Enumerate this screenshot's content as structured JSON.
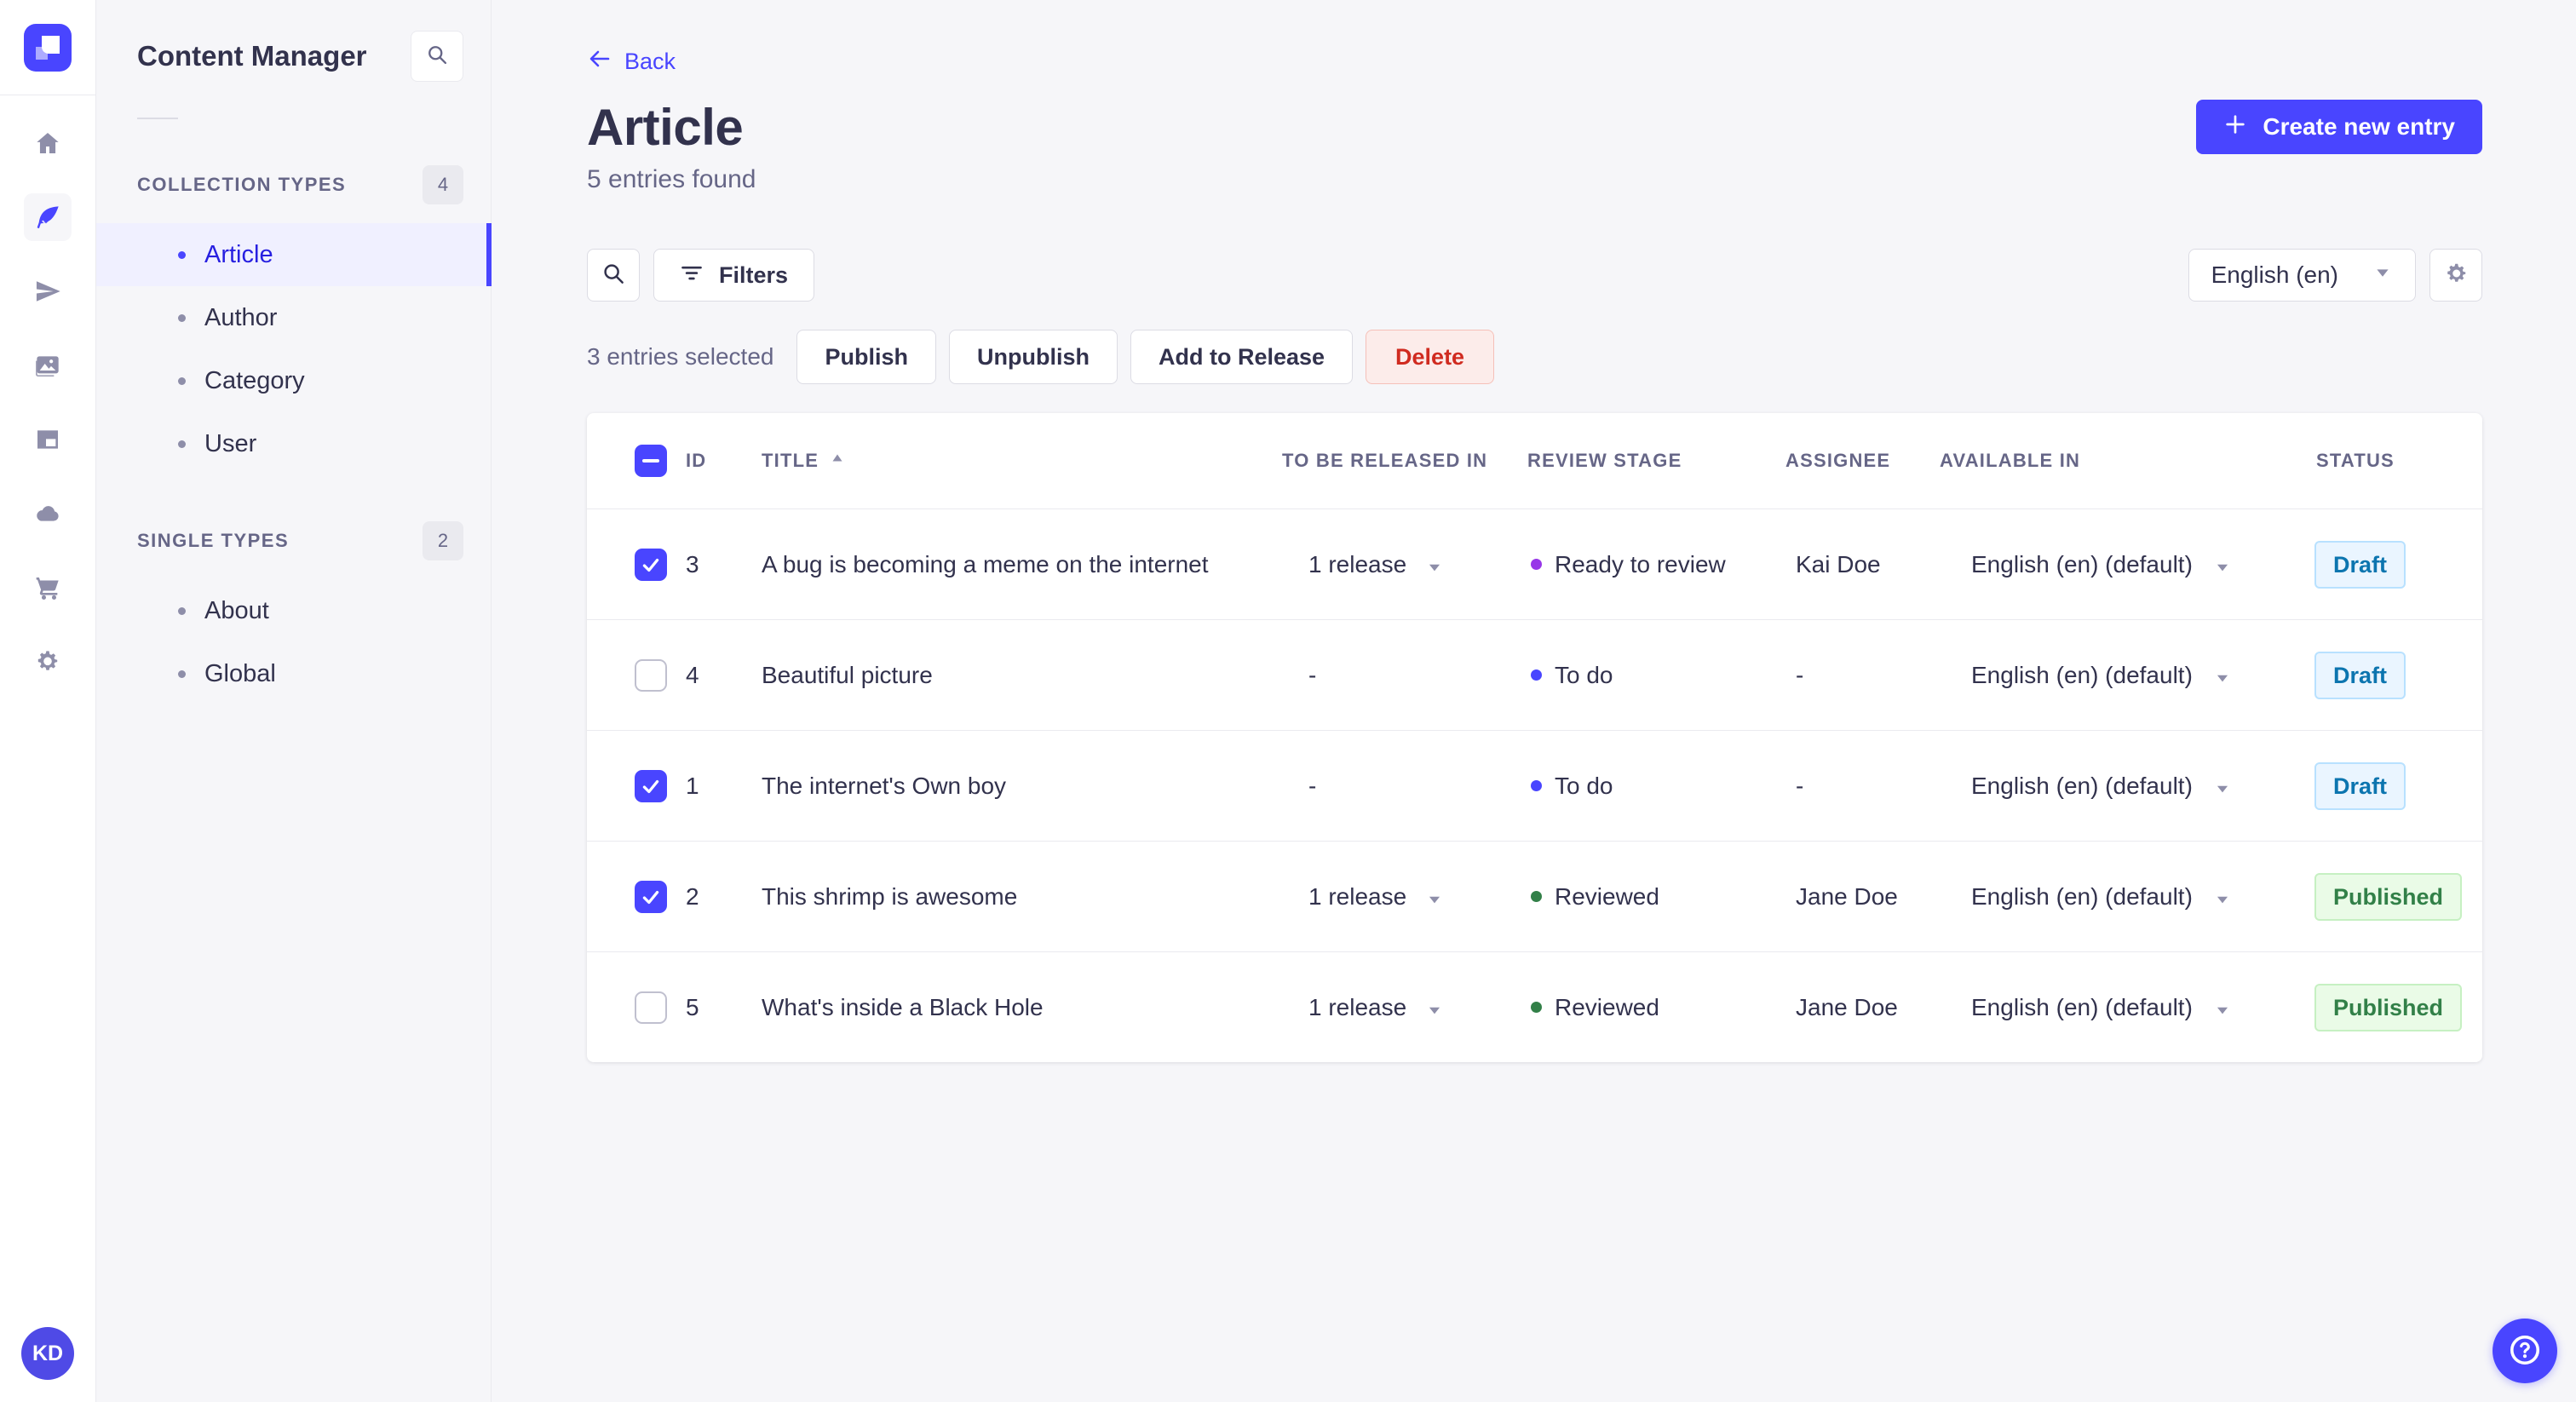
{
  "sidebar": {
    "title": "Content Manager",
    "sections": [
      {
        "label": "COLLECTION TYPES",
        "count": "4",
        "items": [
          {
            "label": "Article",
            "active": true
          },
          {
            "label": "Author",
            "active": false
          },
          {
            "label": "Category",
            "active": false
          },
          {
            "label": "User",
            "active": false
          }
        ]
      },
      {
        "label": "SINGLE TYPES",
        "count": "2",
        "items": [
          {
            "label": "About",
            "active": false
          },
          {
            "label": "Global",
            "active": false
          }
        ]
      }
    ]
  },
  "header": {
    "back_label": "Back",
    "title": "Article",
    "subtitle": "5 entries found",
    "create_button": "Create new entry"
  },
  "toolbar": {
    "filters_label": "Filters",
    "locale_value": "English (en)"
  },
  "bulkbar": {
    "selected_text": "3 entries selected",
    "publish": "Publish",
    "unpublish": "Unpublish",
    "add_to_release": "Add to Release",
    "delete": "Delete"
  },
  "table": {
    "headers": {
      "id": "ID",
      "title": "TITLE",
      "release": "TO BE RELEASED IN",
      "review": "REVIEW STAGE",
      "assignee": "ASSIGNEE",
      "available": "AVAILABLE IN",
      "status": "STATUS"
    },
    "rows": [
      {
        "checked": true,
        "id": "3",
        "title": "A bug is becoming a meme on the internet",
        "release": "1 release",
        "review": "Ready to review",
        "review_color": "#9736e8",
        "assignee": "Kai Doe",
        "available": "English (en) (default)",
        "status": "Draft",
        "status_kind": "draft"
      },
      {
        "checked": false,
        "id": "4",
        "title": "Beautiful picture",
        "release": "-",
        "review": "To do",
        "review_color": "#4945ff",
        "assignee": "-",
        "available": "English (en) (default)",
        "status": "Draft",
        "status_kind": "draft"
      },
      {
        "checked": true,
        "id": "1",
        "title": "The internet's Own boy",
        "release": "-",
        "review": "To do",
        "review_color": "#4945ff",
        "assignee": "-",
        "available": "English (en) (default)",
        "status": "Draft",
        "status_kind": "draft"
      },
      {
        "checked": true,
        "id": "2",
        "title": "This shrimp is awesome",
        "release": "1 release",
        "review": "Reviewed",
        "review_color": "#328048",
        "assignee": "Jane Doe",
        "available": "English (en) (default)",
        "status": "Published",
        "status_kind": "published"
      },
      {
        "checked": false,
        "id": "5",
        "title": "What's inside a Black Hole",
        "release": "1 release",
        "review": "Reviewed",
        "review_color": "#328048",
        "assignee": "Jane Doe",
        "available": "English (en) (default)",
        "status": "Published",
        "status_kind": "published"
      }
    ]
  },
  "user": {
    "initials": "KD"
  },
  "colors": {
    "accent": "#4945ff",
    "danger": "#d02b20",
    "draft": "#0c75af",
    "published": "#328048"
  }
}
